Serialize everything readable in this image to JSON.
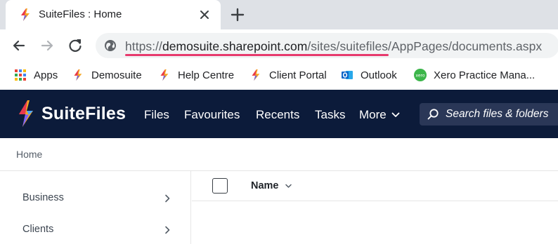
{
  "browser": {
    "tab": {
      "title": "SuiteFiles : Home"
    },
    "url": {
      "scheme": "https://",
      "domain": "demosuite.sharepoint.com",
      "path_highlight": "/sites/suitefiles",
      "path_rest": "/AppPages/documents.aspx"
    },
    "bookmarks": [
      {
        "label": "Apps",
        "icon": "apps-grid-icon"
      },
      {
        "label": "Demosuite",
        "icon": "suitefiles-icon"
      },
      {
        "label": "Help Centre",
        "icon": "suitefiles-icon"
      },
      {
        "label": "Client Portal",
        "icon": "suitefiles-icon"
      },
      {
        "label": "Outlook",
        "icon": "outlook-icon"
      },
      {
        "label": "Xero Practice Mana...",
        "icon": "xero-icon"
      }
    ]
  },
  "app": {
    "brand": "SuiteFiles",
    "nav": [
      "Files",
      "Favourites",
      "Recents",
      "Tasks",
      "More"
    ],
    "search_placeholder": "Search files & folders",
    "breadcrumb": "Home",
    "sidebar": [
      "Business",
      "Clients"
    ],
    "list": {
      "name_column": "Name"
    }
  },
  "colors": {
    "appbar": "#0c1b3a",
    "url_highlight": "#e73a6d",
    "xero": "#13b5ea",
    "outlook": "#0a64c8"
  }
}
